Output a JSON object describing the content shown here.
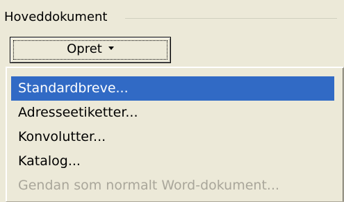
{
  "group": {
    "title": "Hoveddokument"
  },
  "create_button": {
    "label": "Opret",
    "dropdown_icon": "dropdown-arrow-icon"
  },
  "menu": {
    "items": [
      {
        "label": "Standardbreve...",
        "state": "selected"
      },
      {
        "label": "Adresseetiketter...",
        "state": "normal"
      },
      {
        "label": "Konvolutter...",
        "state": "normal"
      },
      {
        "label": "Katalog...",
        "state": "normal"
      },
      {
        "label": "Gendan som normalt Word-dokument...",
        "state": "disabled"
      }
    ]
  },
  "colors": {
    "background": "#ece9d8",
    "selection": "#316ac5",
    "disabled_text": "#a9a69a"
  }
}
